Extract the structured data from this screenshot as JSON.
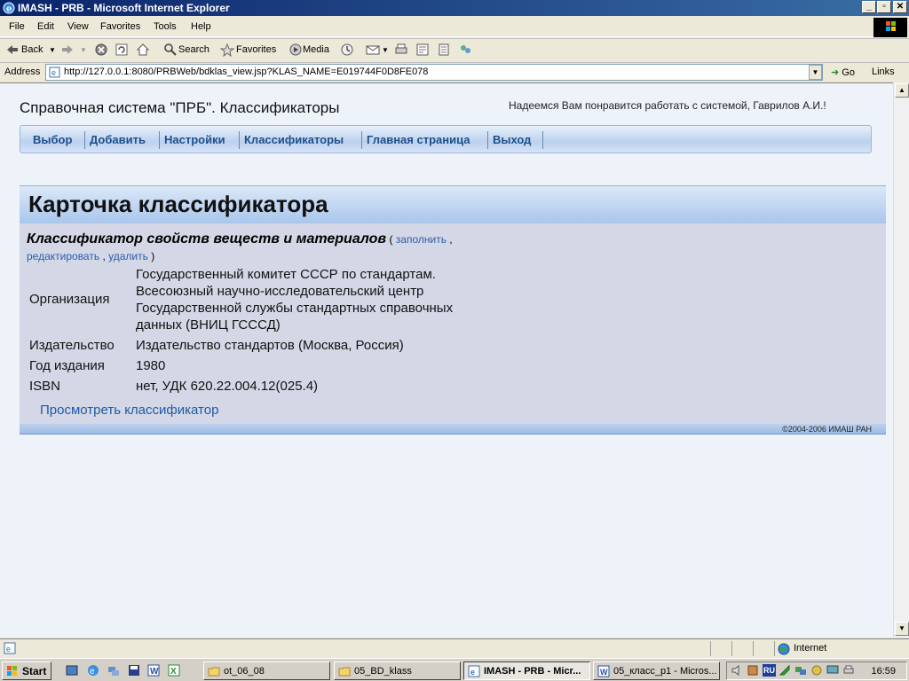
{
  "window": {
    "title": "IMASH - PRB - Microsoft Internet Explorer",
    "minimize_glyph": "_",
    "maximize_glyph": "▫",
    "close_glyph": "✕"
  },
  "menu": [
    "File",
    "Edit",
    "View",
    "Favorites",
    "Tools",
    "Help"
  ],
  "toolbar": {
    "back": "Back",
    "search": "Search",
    "favorites": "Favorites",
    "media": "Media"
  },
  "address": {
    "label": "Address",
    "url": "http://127.0.0.1:8080/PRBWeb/bdklas_view.jsp?KLAS_NAME=E019744F0D8FE078",
    "go": "Go",
    "links": "Links"
  },
  "page": {
    "header": "Справочная система \"ПРБ\". Классификаторы",
    "welcome": "Надеемся Вам понравится работать с системой, Гаврилов А.И.!",
    "nav": [
      "Выбор",
      "Добавить",
      "Настройки",
      "Классификаторы",
      "Главная страница",
      "Выход"
    ]
  },
  "card": {
    "title": "Карточка классификатора",
    "class_name": "Классификатор свойств веществ и материалов",
    "open_paren": "(",
    "close_paren": ")",
    "sep": ",",
    "actions": {
      "fill": "заполнить",
      "edit": "редактировать",
      "delete": "удалить"
    },
    "org_label": "Организация",
    "org_lines": [
      "Государственный комитет СССР по стандартам.",
      "Всесоюзный научно-исследовательский центр",
      "Государственной службы стандартных справочных",
      "данных (ВНИЦ ГСССД)"
    ],
    "publisher_label": "Издательство",
    "publisher": "Издательство стандартов (Москва, Россия)",
    "year_label": "Год издания",
    "year": "1980",
    "isbn_label": "ISBN",
    "isbn": "нет, УДК 620.22.004.12(025.4)",
    "view_link": "Просмотреть классификатор",
    "copyright": "©2004-2006 ИМАШ РАН"
  },
  "statusbar": {
    "zone": "Internet"
  },
  "taskbar": {
    "start": "Start",
    "tasks": [
      "ot_06_08",
      "05_BD_klass",
      "IMASH - PRB - Micr...",
      "05_класс_р1 - Micros..."
    ],
    "tray_lang": "RU",
    "clock": "16:59"
  },
  "colors": {
    "title_bar": "#0a246a",
    "nav_text": "#1d4f8c",
    "link": "#2a5da8",
    "card_body": "#d4d8e6"
  }
}
